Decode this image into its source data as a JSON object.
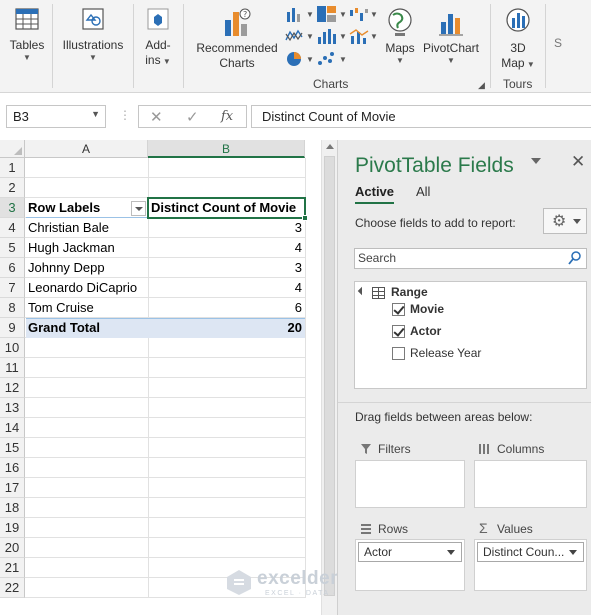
{
  "ribbon": {
    "tables_label": "Tables",
    "illustrations_label": "Illustrations",
    "addins_label_1": "Add-",
    "addins_label_2": "ins",
    "recommended_label_1": "Recommended",
    "recommended_label_2": "Charts",
    "maps_label": "Maps",
    "pivotchart_label": "PivotChart",
    "map3d_label_1": "3D",
    "map3d_label_2": "Map",
    "charts_group": "Charts",
    "tours_group": "Tours",
    "partial_label": "S"
  },
  "formula_bar": {
    "name_box": "B3",
    "fx": "fx",
    "content": "Distinct Count of Movie"
  },
  "sheet": {
    "columns": [
      "A",
      "B"
    ],
    "rows": [
      "1",
      "2",
      "3",
      "4",
      "5",
      "6",
      "7",
      "8",
      "9",
      "10",
      "11",
      "12",
      "13",
      "14",
      "15",
      "16",
      "17",
      "18",
      "19",
      "20",
      "21",
      "22"
    ],
    "header": {
      "a": "Row Labels",
      "b": "Distinct Count of Movie"
    },
    "data": [
      {
        "name": "Christian Bale",
        "count": "3"
      },
      {
        "name": "Hugh Jackman",
        "count": "4"
      },
      {
        "name": "Johnny Depp",
        "count": "3"
      },
      {
        "name": "Leonardo DiCaprio",
        "count": "4"
      },
      {
        "name": "Tom Cruise",
        "count": "6"
      }
    ],
    "total": {
      "label": "Grand Total",
      "value": "20"
    }
  },
  "pivot_panel": {
    "title": "PivotTable Fields",
    "tab_active": "Active",
    "tab_all": "All",
    "choose_label": "Choose fields to add to report:",
    "search_placeholder": "Search",
    "range_label": "Range",
    "fields": [
      {
        "label": "Movie",
        "checked": true
      },
      {
        "label": "Actor",
        "checked": true
      },
      {
        "label": "Release Year",
        "checked": false
      }
    ],
    "drag_label": "Drag fields between areas below:",
    "areas": {
      "filters": "Filters",
      "columns": "Columns",
      "rows": "Rows",
      "values": "Values"
    },
    "rows_pill": "Actor",
    "values_pill": "Distinct Coun..."
  },
  "watermark": {
    "brand": "exceldemy",
    "tagline": "EXCEL · DATA · BI"
  }
}
